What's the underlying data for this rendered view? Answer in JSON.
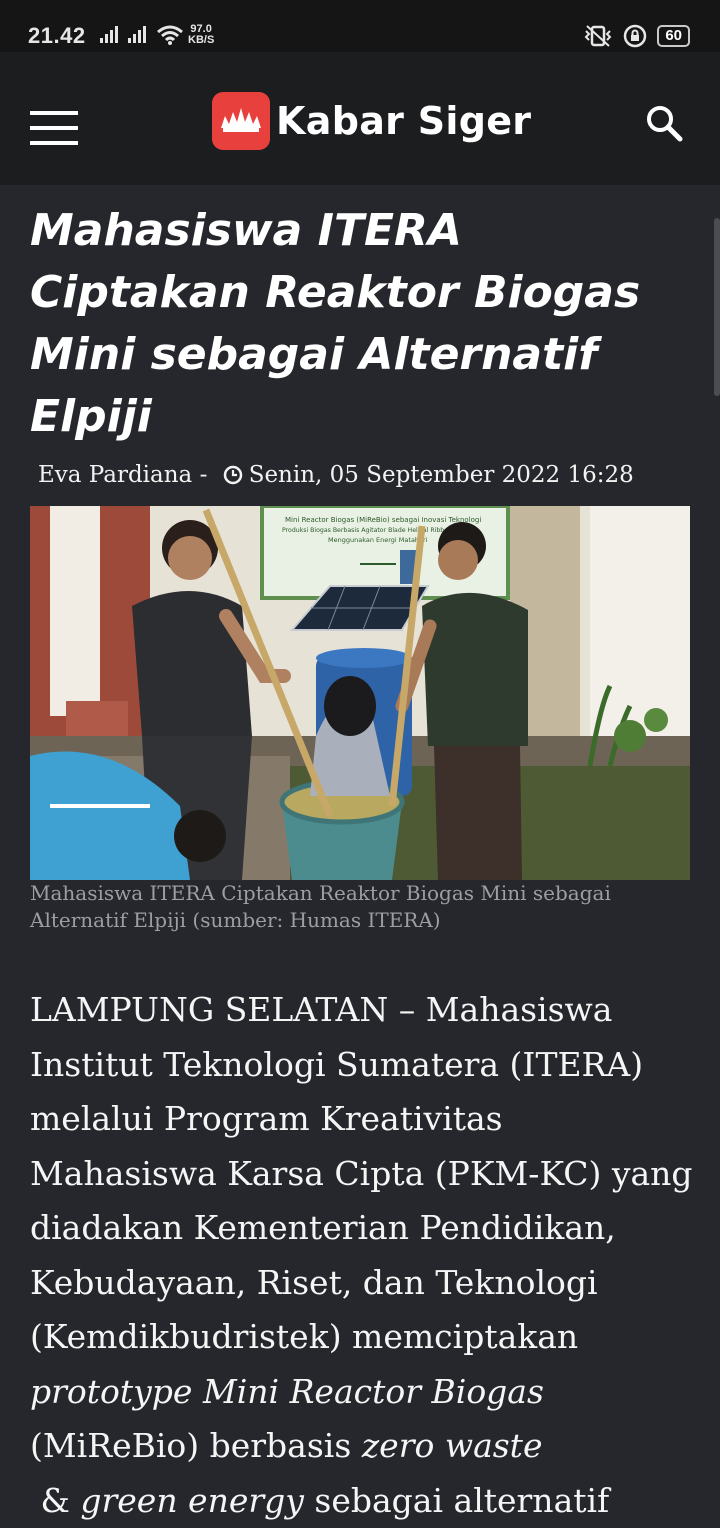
{
  "status_bar": {
    "time": "21.42",
    "speed_value": "97.0",
    "speed_unit": "KB/S",
    "battery": "60"
  },
  "header": {
    "brand": "Kabar Siger"
  },
  "article": {
    "title": "Mahasiswa ITERA Ciptakan Reaktor Biogas Mini sebagai Alternatif Elpiji",
    "author": "Eva Pardiana",
    "separator": " - ",
    "date": "Senin, 05 September 2022 16:28",
    "image": {
      "banner_line1": "Mini Reactor Biogas (MiReBio) sebagai Inovasi Teknologi",
      "banner_line2": "Produksi Biogas Berbasis Agitator Blade Helical Ribbon dengan",
      "banner_line3": "Menggunakan Energi Matahari"
    },
    "caption": "Mahasiswa ITERA Ciptakan Reaktor Biogas Mini sebagai Alternatif Elpiji (sumber: Humas ITERA)",
    "body": {
      "p1": "LAMPUNG SELATAN – Mahasiswa Institut Teknologi Sumatera (ITERA) melalui Program Kreativitas Mahasiswa Karsa Cipta (PKM-KC) yang diadakan Kementerian Pendidikan, Kebudayaan, Riset, dan Teknologi (Kemdikbudristek) memciptakan ",
      "em1": "prototype Mini Reactor Biogas",
      "p2": " (MiReBio) berbasis ",
      "em2": "zero waste",
      "p3": " & ",
      "em3": "green energy",
      "p4": " sebagai alternatif"
    }
  },
  "colors": {
    "background": "#25272c",
    "appbar": "#1c1d1f",
    "statusbar": "#151515",
    "brand_red": "#e8403d",
    "caption": "#9c9ea3"
  },
  "icons": [
    "menu-icon",
    "logo-icon",
    "search-icon",
    "clock-icon",
    "wifi-icon",
    "vibrate-icon",
    "lock-icon",
    "battery-icon"
  ]
}
